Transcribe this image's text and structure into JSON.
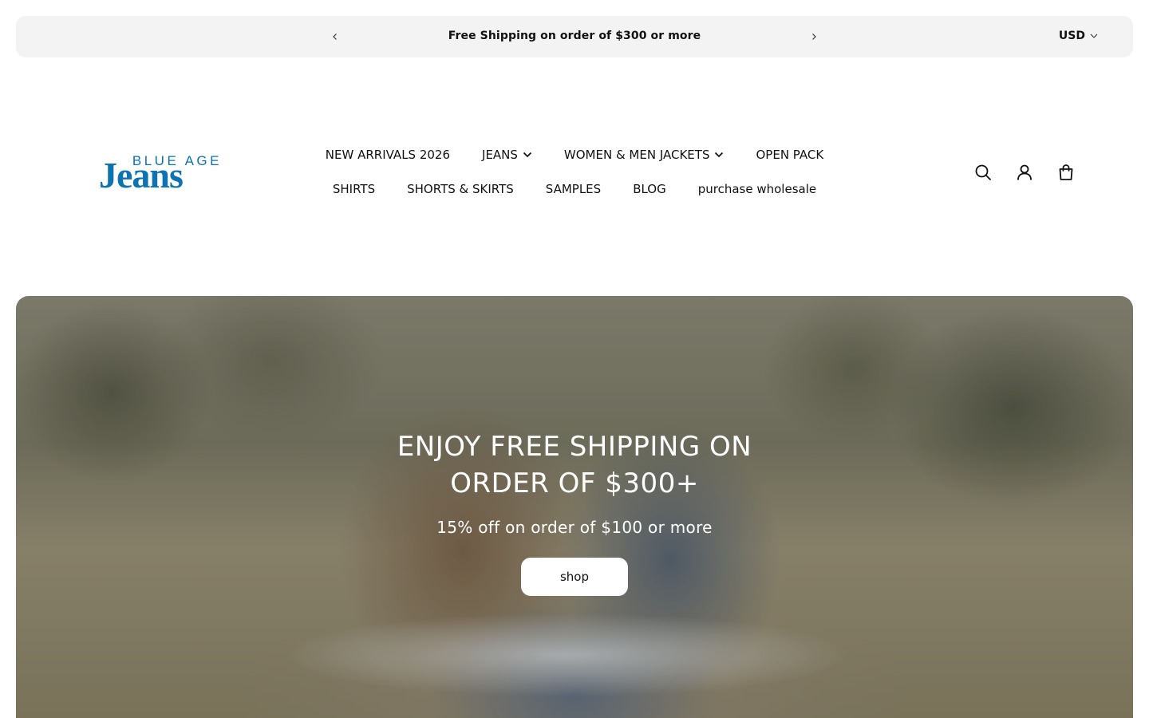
{
  "announcement": {
    "message": "Free Shipping on order of $300 or more",
    "currency": "USD"
  },
  "brand": {
    "logo_top": "BLUE AGE",
    "logo_bottom": "Jeans",
    "color": "#0d73b3"
  },
  "nav": {
    "row1": [
      {
        "label": "NEW ARRIVALS 2026",
        "has_dropdown": false
      },
      {
        "label": "JEANS",
        "has_dropdown": true
      },
      {
        "label": "WOMEN & MEN JACKETS",
        "has_dropdown": true
      },
      {
        "label": "OPEN PACK",
        "has_dropdown": false
      }
    ],
    "row2": [
      {
        "label": "SHIRTS"
      },
      {
        "label": "SHORTS & SKIRTS"
      },
      {
        "label": "SAMPLES"
      },
      {
        "label": "BLOG"
      },
      {
        "label": "purchase wholesale"
      }
    ]
  },
  "header_icons": [
    "search-icon",
    "account-icon",
    "cart-icon"
  ],
  "hero": {
    "title": "ENJOY FREE SHIPPING ON ORDER OF $300+",
    "subtitle": "15% off on order of $100 or more",
    "button_label": "shop"
  }
}
